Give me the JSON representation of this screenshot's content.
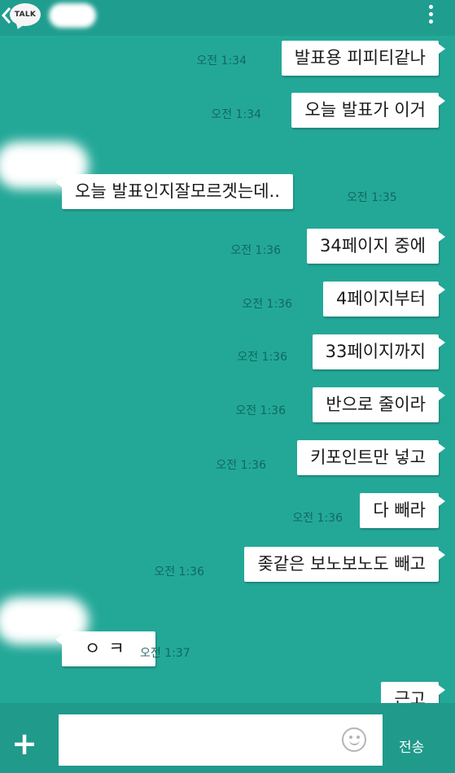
{
  "header": {
    "logo_text": "TALK",
    "icons": {
      "back": "chevron-left-icon",
      "menu": "more-vertical-icon"
    }
  },
  "messages": [
    {
      "side": "right",
      "text": "발표용 피피티같나",
      "time": "오전 1:34"
    },
    {
      "side": "right",
      "text": "오늘 발표가 이거",
      "time": "오전 1:34"
    },
    {
      "side": "left",
      "text": "오늘 발표인지잘모르겟는데..",
      "time": "오전 1:35"
    },
    {
      "side": "right",
      "text": "34페이지 중에",
      "time": "오전 1:36"
    },
    {
      "side": "right",
      "text": "4페이지부터",
      "time": "오전 1:36"
    },
    {
      "side": "right",
      "text": "33페이지까지",
      "time": "오전 1:36"
    },
    {
      "side": "right",
      "text": "반으로 줄이라",
      "time": "오전 1:36"
    },
    {
      "side": "right",
      "text": "키포인트만 넣고",
      "time": "오전 1:36"
    },
    {
      "side": "right",
      "text": "다 빼라",
      "time": "오전 1:36"
    },
    {
      "side": "right",
      "text": "좆같은 보노보노도 빼고",
      "time": "오전 1:36"
    },
    {
      "side": "left",
      "text": "ㅇㅋ",
      "time": "오전 1:37"
    },
    {
      "side": "right",
      "text": "근고",
      "time": ""
    }
  ],
  "composer": {
    "input_value": "",
    "send_label": "전송",
    "icons": {
      "attach": "plus-icon",
      "emoticon": "smiley-icon"
    }
  },
  "colors": {
    "background": "#23a898",
    "bubble": "#ffffff",
    "timestamp": "#0f5d55",
    "bar": "#1f9e8f"
  }
}
